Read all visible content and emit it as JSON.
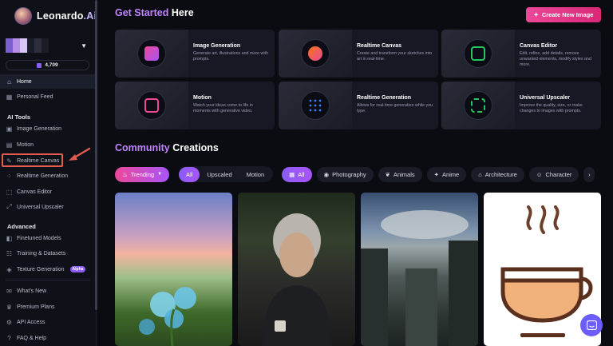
{
  "brand": {
    "name": "Leonardo",
    "suffix": ".Ai"
  },
  "account": {
    "tokens": "4,709"
  },
  "sidebar": {
    "home": "Home",
    "personal_feed": "Personal Feed",
    "ai_tools_label": "AI Tools",
    "tools": [
      "Image Generation",
      "Motion",
      "Realtime Canvas",
      "Realtime Generation",
      "Canvas Editor",
      "Universal Upscaler"
    ],
    "advanced_label": "Advanced",
    "advanced": [
      "Finetuned Models",
      "Training & Datasets",
      "Texture Generation"
    ],
    "alpha_badge": "Alpha",
    "footer": [
      "What's New",
      "Premium Plans",
      "API Access",
      "FAQ & Help"
    ]
  },
  "header": {
    "get_started_accent": "Get Started",
    "get_started_rest": " Here",
    "create_button": "Create New Image"
  },
  "cards": [
    {
      "title": "Image Generation",
      "desc": "Generate art, illustrations and more with prompts.",
      "color": "#ec4899"
    },
    {
      "title": "Realtime Canvas",
      "desc": "Create and transform your sketches into art in real-time.",
      "color": "#f97316"
    },
    {
      "title": "Canvas Editor",
      "desc": "Edit, refine, add details, remove unwanted elements, modify styles and more.",
      "color": "#22c55e"
    },
    {
      "title": "Motion",
      "desc": "Watch your ideas come to life in moments with generative video.",
      "color": "#ec4899"
    },
    {
      "title": "Realtime Generation",
      "desc": "Allows for real-time generation while you type.",
      "color": "#3b82f6"
    },
    {
      "title": "Universal Upscaler",
      "desc": "Improve the quality, size, or make changes to images with prompts.",
      "color": "#22c55e"
    }
  ],
  "community": {
    "accent": "Community",
    "rest": " Creations"
  },
  "filters": {
    "trending": "Trending",
    "media": [
      "All",
      "Upscaled",
      "Motion"
    ],
    "categories": [
      "All",
      "Photography",
      "Animals",
      "Anime",
      "Architecture",
      "Character"
    ]
  },
  "colors": {
    "accent": "#c084fc",
    "pink": "#ec4899",
    "highlight": "#e35a4f"
  }
}
